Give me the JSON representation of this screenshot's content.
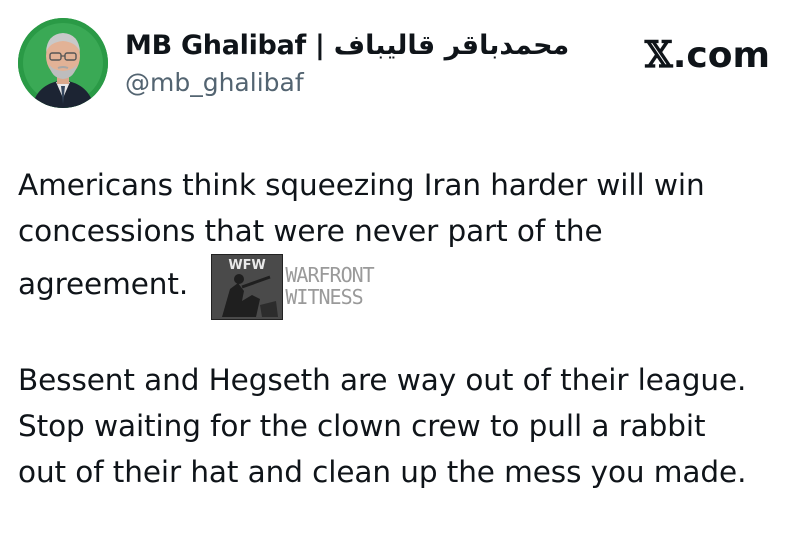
{
  "user": {
    "display_name": "MB Ghalibaf | محمدباقر قالیباف",
    "handle": "@mb_ghalibaf"
  },
  "brand": {
    "label": ".com"
  },
  "tweet": {
    "paragraph1_line1": "Americans think squeezing Iran harder will win",
    "paragraph1_line2": "concessions that were never part of the",
    "paragraph1_line3": "agreement.",
    "paragraph2_line1": "Bessent and Hegseth are way out of their league.",
    "paragraph2_line2": "Stop waiting for the clown crew to pull a rabbit",
    "paragraph2_line3": "out of their hat and clean up the mess you made."
  },
  "watermark": {
    "badge_text": "WFW",
    "line1": "WARFRONT",
    "line2": "WITNESS"
  },
  "colors": {
    "avatar_bg": "#2a9a46",
    "handle": "#536471",
    "text": "#0f1419"
  }
}
